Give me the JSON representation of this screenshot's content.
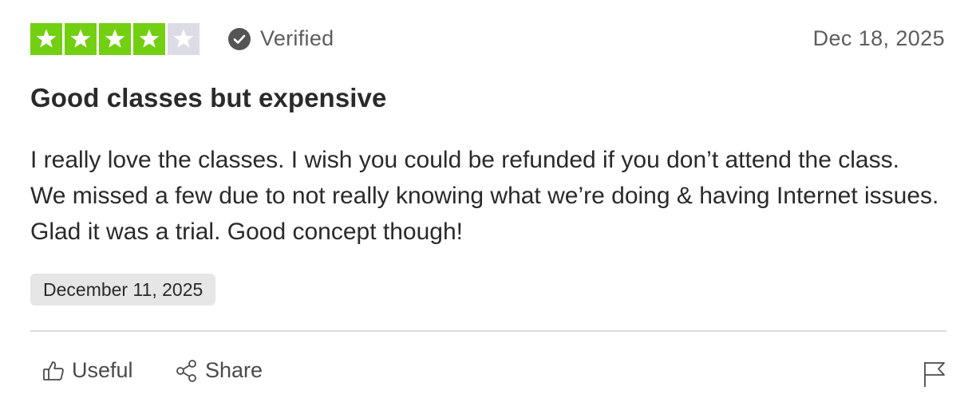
{
  "review": {
    "rating": 4,
    "max_rating": 5,
    "star_filled_color": "#73cf11",
    "star_empty_color": "#dcdce6",
    "verified_label": "Verified",
    "date_posted": "Dec 18, 2025",
    "title": "Good classes but expensive",
    "body": "I really love the classes. I wish you could be refunded if you don’t attend the class. We missed a few due to not really knowing what we’re doing & having Internet issues. Glad it was a trial. Good concept though!",
    "experience_date": "December 11, 2025"
  },
  "actions": {
    "useful_label": "Useful",
    "share_label": "Share",
    "icons": [
      "thumbs-up-icon",
      "share-icon",
      "flag-icon"
    ]
  }
}
